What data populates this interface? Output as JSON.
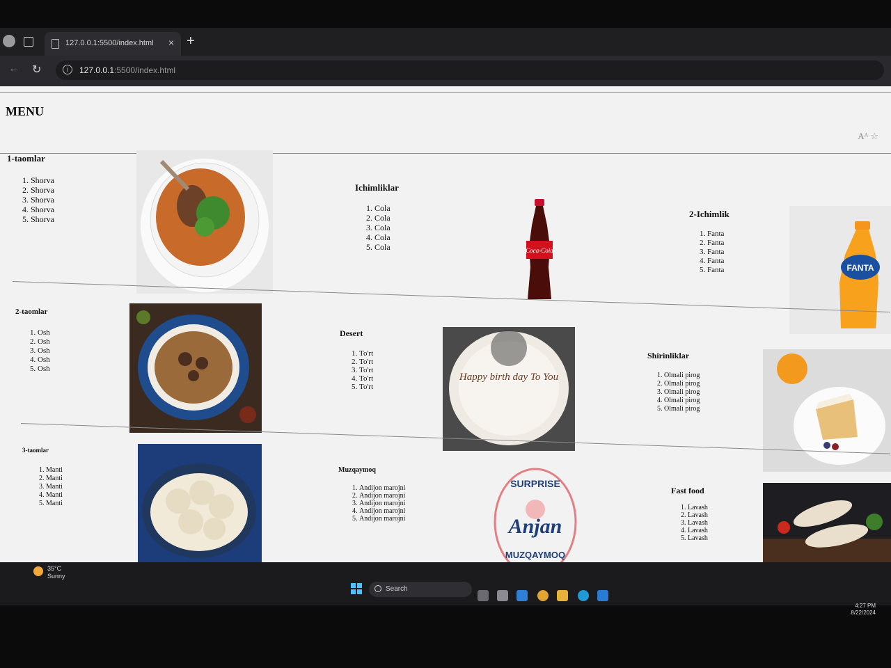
{
  "browser": {
    "tab_title": "127.0.0.1:5500/index.html",
    "url_host": "127.0.0.1",
    "url_rest": ":5500/index.html",
    "new_tab": "+",
    "close": "×"
  },
  "page": {
    "title": "MENU",
    "sections": [
      {
        "heading": "1-taomlar",
        "items": [
          "Shorva",
          "Shorva",
          "Shorva",
          "Shorva",
          "Shorva"
        ],
        "image": "soup-image"
      },
      {
        "heading": "Ichimliklar",
        "items": [
          "Cola",
          "Cola",
          "Cola",
          "Cola",
          "Cola"
        ],
        "image": "cola-bottle-image"
      },
      {
        "heading": "2-Ichimlik",
        "items": [
          "Fanta",
          "Fanta",
          "Fanta",
          "Fanta",
          "Fanta"
        ],
        "image": "fanta-bottle-image"
      },
      {
        "heading": "2-taomlar",
        "items": [
          "Osh",
          "Osh",
          "Osh",
          "Osh",
          "Osh"
        ],
        "image": "plov-image"
      },
      {
        "heading": "Desert",
        "items": [
          "To'rt",
          "To'rt",
          "To'rt",
          "To'rt",
          "To'rt"
        ],
        "image": "birthday-cake-image"
      },
      {
        "heading": "Shirinliklar",
        "items": [
          "Olmali pirog",
          "Olmali pirog",
          "Olmali pirog",
          "Olmali pirog",
          "Olmali pirog"
        ],
        "image": "pie-slice-image"
      },
      {
        "heading": "3-taomlar",
        "items": [
          "Manti",
          "Manti",
          "Manti",
          "Manti",
          "Manti"
        ],
        "image": "manti-image"
      },
      {
        "heading": "Muzqaymoq",
        "items": [
          "Andijon marojni",
          "Andijon marojni",
          "Andijon marojni",
          "Andijon marojni",
          "Andijon marojni"
        ],
        "image": "anjan-logo-image"
      },
      {
        "heading": "Fast food",
        "items": [
          "Lavash",
          "Lavash",
          "Lavash",
          "Lavash",
          "Lavash"
        ],
        "image": "lavash-image"
      }
    ],
    "cake_text": "Happy birth day To You",
    "logo": {
      "top": "SURPRISE",
      "main": "Anjan",
      "bottom": "MUZQAYMOQ"
    },
    "cola_label": "Coca-Cola",
    "fanta_label": "FANTA"
  },
  "taskbar": {
    "temp": "35°C",
    "condition": "Sunny",
    "search_placeholder": "Search",
    "time": "4:27 PM",
    "date": "8/22/2024"
  }
}
